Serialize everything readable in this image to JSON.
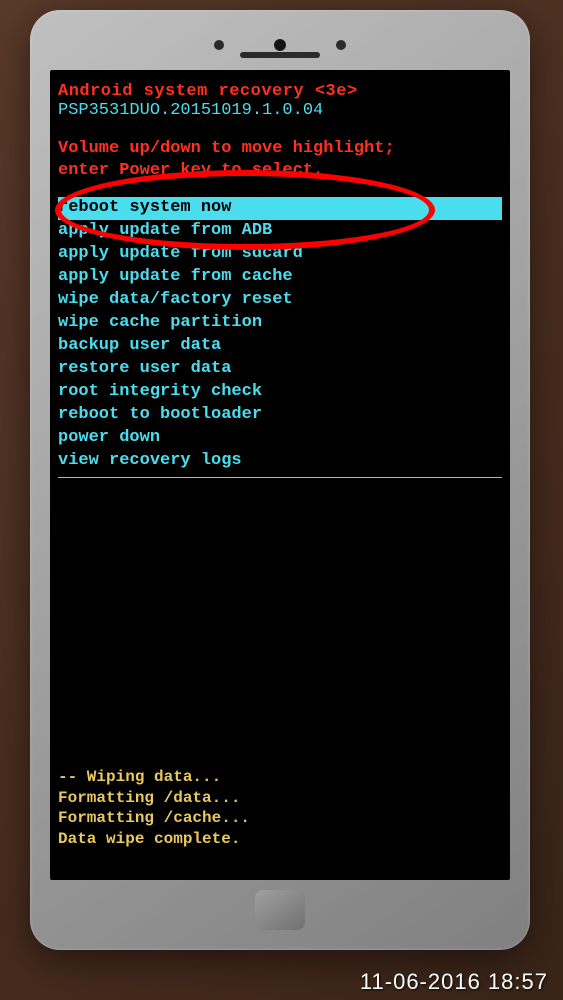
{
  "header": {
    "title": "Android system recovery <3e>",
    "version": "PSP3531DUO.20151019.1.0.04"
  },
  "instructions": {
    "line1": "Volume up/down to move highlight;",
    "line2": "enter Power key to select."
  },
  "menu": {
    "items": [
      {
        "label": "reboot system now",
        "selected": true
      },
      {
        "label": "apply update from ADB",
        "selected": false
      },
      {
        "label": "apply update from sdcard",
        "selected": false
      },
      {
        "label": "apply update from cache",
        "selected": false
      },
      {
        "label": "wipe data/factory reset",
        "selected": false
      },
      {
        "label": "wipe cache partition",
        "selected": false
      },
      {
        "label": "backup user data",
        "selected": false
      },
      {
        "label": "restore user data",
        "selected": false
      },
      {
        "label": "root integrity check",
        "selected": false
      },
      {
        "label": "reboot to bootloader",
        "selected": false
      },
      {
        "label": "power down",
        "selected": false
      },
      {
        "label": "view recovery logs",
        "selected": false
      }
    ]
  },
  "status": {
    "lines": [
      "-- Wiping data...",
      "Formatting /data...",
      "Formatting /cache...",
      "Data wipe complete."
    ]
  },
  "photo_timestamp": "11-06-2016 18:57"
}
